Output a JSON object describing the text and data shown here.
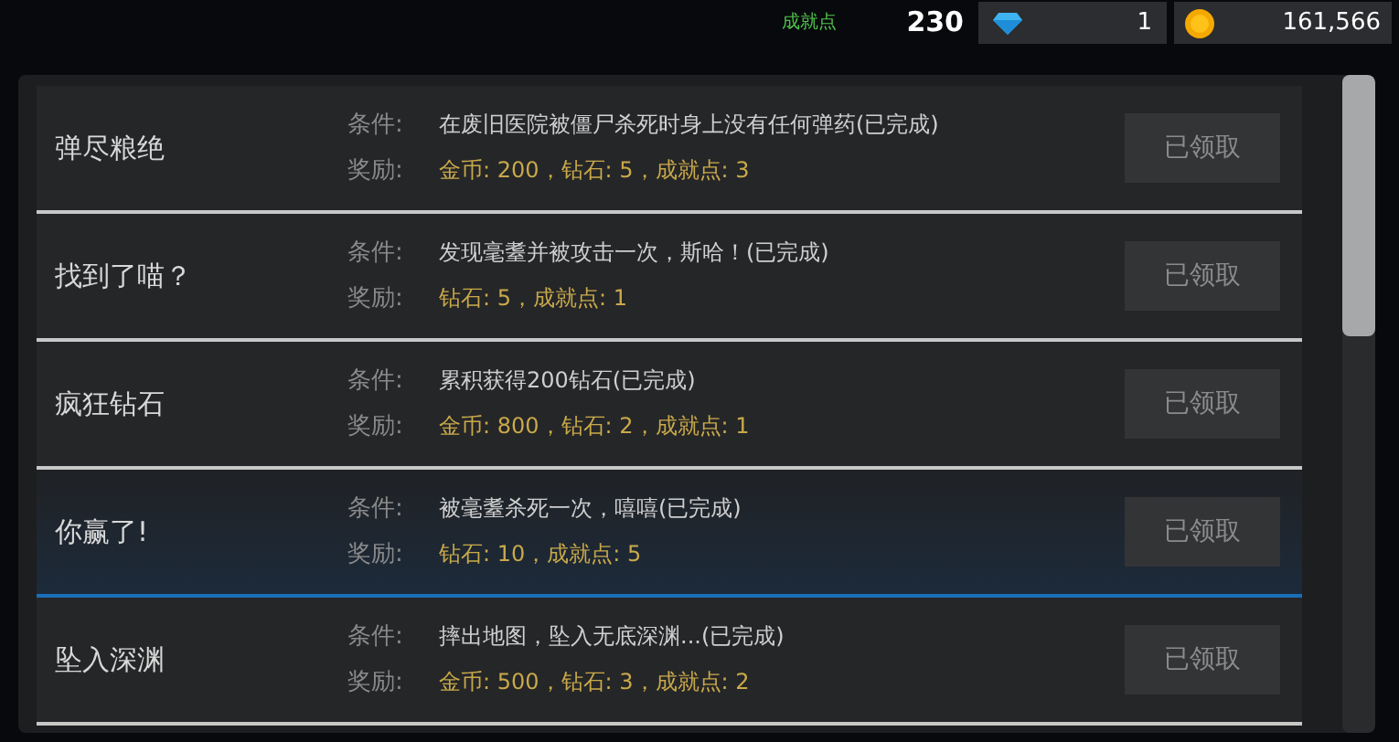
{
  "top_bar": {
    "achievement_label": "成就点",
    "achievement_points": "230",
    "diamonds": "1",
    "coins": "161,566"
  },
  "achievements": [
    {
      "title": "弹尽粮绝",
      "condition_label": "条件:",
      "condition": "在废旧医院被僵尸杀死时身上没有任何弹药(已完成)",
      "reward_label": "奖励:",
      "reward": "金币: 200，钻石: 5，成就点: 3",
      "button": "已领取",
      "disabled": true,
      "selected": false
    },
    {
      "title": "找到了喵？",
      "condition_label": "条件:",
      "condition": "发现毫耋并被攻击一次，斯哈！(已完成)",
      "reward_label": "奖励:",
      "reward": "钻石: 5，成就点: 1",
      "button": "已领取",
      "disabled": true,
      "selected": false
    },
    {
      "title": "疯狂钻石",
      "condition_label": "条件:",
      "condition": "累积获得200钻石(已完成)",
      "reward_label": "奖励:",
      "reward": "金币: 800，钻石: 2，成就点: 1",
      "button": "已领取",
      "disabled": true,
      "selected": false
    },
    {
      "title": "你赢了!",
      "condition_label": "条件:",
      "condition": "被毫耋杀死一次，嘻嘻(已完成)",
      "reward_label": "奖励:",
      "reward": "钻石: 10，成就点: 5",
      "button": "已领取",
      "disabled": true,
      "selected": true
    },
    {
      "title": "坠入深渊",
      "condition_label": "条件:",
      "condition": "摔出地图，坠入无底深渊...(已完成)",
      "reward_label": "奖励:",
      "reward": "金币: 500，钻石: 3，成就点: 2",
      "button": "已领取",
      "disabled": true,
      "selected": false
    }
  ]
}
